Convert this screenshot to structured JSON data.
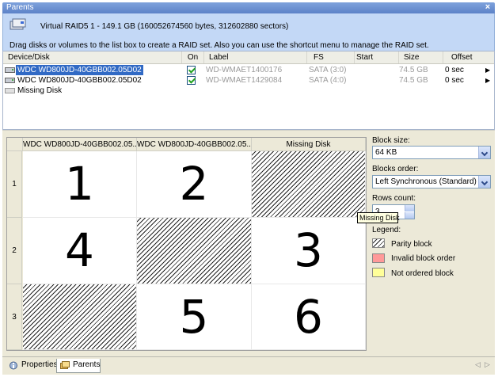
{
  "window": {
    "title": "Parents",
    "close_glyph": "×"
  },
  "header": {
    "volume_title": "Virtual RAID5 1 - 149.1 GB (160052674560 bytes, 312602880 sectors)",
    "hint": "Drag disks or volumes to the list box to create a RAID set. Also you can use the shortcut menu to manage the RAID set."
  },
  "table": {
    "columns": [
      "Device/Disk",
      "On",
      "Label",
      "FS",
      "Start",
      "Size",
      "Offset"
    ],
    "rows": [
      {
        "device": "WDC WD800JD-40GBB002.05D02",
        "on": true,
        "label": "WD-WMAET1400176",
        "fs": "SATA (3:0)",
        "start": "",
        "size": "74.5 GB",
        "offset": "0 sec",
        "arrow": "▶"
      },
      {
        "device": "WDC WD800JD-40GBB002.05D02",
        "on": true,
        "label": "WD-WMAET1429084",
        "fs": "SATA (4:0)",
        "start": "",
        "size": "74.5 GB",
        "offset": "0 sec",
        "arrow": "▶"
      },
      {
        "device": "Missing Disk"
      }
    ]
  },
  "grid": {
    "columns": [
      "WDC WD800JD-40GBB002.05...",
      "WDC WD800JD-40GBB002.05...",
      "Missing Disk"
    ],
    "row_labels": [
      "1",
      "2",
      "3"
    ],
    "cells": [
      [
        "1",
        "2",
        "parity"
      ],
      [
        "4",
        "parity",
        "3"
      ],
      [
        "parity",
        "5",
        "6"
      ]
    ]
  },
  "settings": {
    "block_size_label": "Block size:",
    "block_size_value": "64 KB",
    "blocks_order_label": "Blocks order:",
    "blocks_order_value": "Left Synchronous (Standard)",
    "rows_count_label": "Rows count:",
    "rows_count_value": "3",
    "legend_label": "Legend:",
    "legend": [
      {
        "name": "Parity block",
        "color": "hatched"
      },
      {
        "name": "Invalid block order",
        "color": "#ff9999"
      },
      {
        "name": "Not ordered block",
        "color": "#ffff99"
      }
    ]
  },
  "tooltip": "Missing Disk",
  "tabs": [
    {
      "label": "Properties",
      "active": false
    },
    {
      "label": "Parents",
      "active": true
    }
  ],
  "nav": {
    "prev": "◁",
    "next": "▷"
  }
}
